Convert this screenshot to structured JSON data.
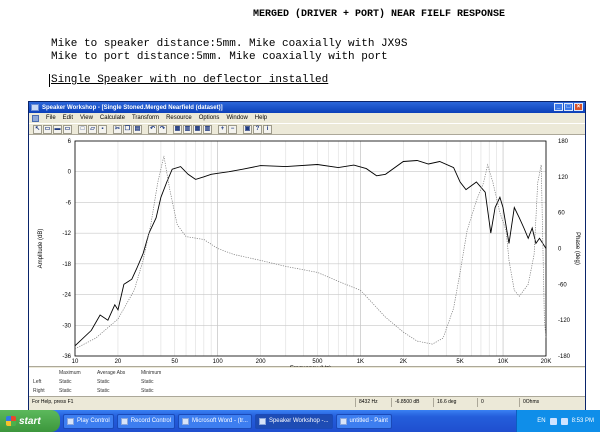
{
  "document": {
    "title": "MERGED (DRIVER + PORT) NEAR FIELF RESPONSE",
    "line1": "Mike to speaker distance:5mm. Mike coaxially with JX9S",
    "line2": "Mike to port distance:5mm. Mike coaxially with port",
    "line3": "Single Speaker with no deflector installed"
  },
  "window": {
    "title": "Speaker Workshop - [Single Stoned.Merged Nearfield (dataset)]",
    "buttons": [
      "_",
      "□",
      "×"
    ],
    "menu": [
      "File",
      "Edit",
      "View",
      "Calculate",
      "Transform",
      "Resource",
      "Options",
      "Window",
      "Help"
    ],
    "toolbar_icons": [
      "pointer-icon",
      "view1-icon",
      "view2-icon",
      "view3-icon",
      "new-icon",
      "open-icon",
      "save-icon",
      "cut-icon",
      "copy-icon",
      "paste-icon",
      "undo-icon",
      "redo-icon",
      "chart1-icon",
      "chart2-icon",
      "chart3-icon",
      "chart4-icon",
      "zoom-in-icon",
      "zoom-out-icon",
      "print-icon",
      "help-icon",
      "about-icon"
    ]
  },
  "chart_data": {
    "type": "line",
    "xlabel": "Frequency (Hz)",
    "ylabel_left": "Amplitude (dB)",
    "ylabel_right": "Phase (deg)",
    "x_scale": "log",
    "xlim": [
      10,
      20000
    ],
    "ylim_left": [
      -36,
      6
    ],
    "ylim_right": [
      -180,
      180
    ],
    "x_ticks": [
      "10",
      "20",
      "50",
      "100",
      "200",
      "500",
      "1K",
      "2K",
      "5K",
      "10K",
      "20K"
    ],
    "y_ticks_left": [
      "6",
      "0",
      "-6",
      "-12",
      "-18",
      "-24",
      "-30",
      "-36"
    ],
    "y_ticks_right": [
      "180",
      "120",
      "60",
      "0",
      "-60",
      "-120",
      "-180"
    ],
    "grid": true,
    "series": [
      {
        "axis": "left",
        "style": "solid",
        "color": "#000000",
        "points": [
          [
            10,
            -34
          ],
          [
            13,
            -31
          ],
          [
            15,
            -28
          ],
          [
            17,
            -29
          ],
          [
            19,
            -26
          ],
          [
            20,
            -27
          ],
          [
            22,
            -22
          ],
          [
            25,
            -21
          ],
          [
            27,
            -19
          ],
          [
            30,
            -16
          ],
          [
            33,
            -12
          ],
          [
            37,
            -9
          ],
          [
            40,
            -5
          ],
          [
            44,
            -2
          ],
          [
            48,
            0.5
          ],
          [
            55,
            1
          ],
          [
            62,
            -0.5
          ],
          [
            70,
            -1.5
          ],
          [
            80,
            -1
          ],
          [
            90,
            -0.5
          ],
          [
            100,
            -0.3
          ],
          [
            120,
            0
          ],
          [
            150,
            0.5
          ],
          [
            200,
            1.2
          ],
          [
            300,
            1
          ],
          [
            500,
            1.4
          ],
          [
            700,
            0.8
          ],
          [
            900,
            1.3
          ],
          [
            1100,
            0.6
          ],
          [
            1300,
            -0.8
          ],
          [
            1500,
            -0.5
          ],
          [
            2000,
            2
          ],
          [
            2500,
            2.2
          ],
          [
            3000,
            1.5
          ],
          [
            3600,
            2
          ],
          [
            4500,
            0.8
          ],
          [
            5000,
            -2
          ],
          [
            5500,
            -3.5
          ],
          [
            6500,
            -2
          ],
          [
            7500,
            -4
          ],
          [
            8200,
            -12
          ],
          [
            8800,
            -7
          ],
          [
            9500,
            -5
          ],
          [
            10000,
            -7
          ],
          [
            11000,
            -14
          ],
          [
            12000,
            -7
          ],
          [
            13000,
            -9
          ],
          [
            14000,
            -11
          ],
          [
            15000,
            -13
          ],
          [
            16000,
            -11
          ],
          [
            17000,
            -14
          ],
          [
            18000,
            -13
          ],
          [
            20000,
            -15
          ]
        ]
      },
      {
        "axis": "right",
        "style": "dotted",
        "color": "#777777",
        "points": [
          [
            10,
            -168
          ],
          [
            14,
            -150
          ],
          [
            20,
            -118
          ],
          [
            26,
            -70
          ],
          [
            30,
            -20
          ],
          [
            34,
            40
          ],
          [
            38,
            110
          ],
          [
            42,
            155
          ],
          [
            46,
            100
          ],
          [
            52,
            40
          ],
          [
            60,
            20
          ],
          [
            80,
            15
          ],
          [
            100,
            0
          ],
          [
            130,
            -10
          ],
          [
            200,
            -20
          ],
          [
            300,
            -30
          ],
          [
            500,
            -40
          ],
          [
            700,
            -55
          ],
          [
            1000,
            -70
          ],
          [
            1200,
            -90
          ],
          [
            1500,
            -115
          ],
          [
            2000,
            -140
          ],
          [
            2500,
            -155
          ],
          [
            3200,
            -160
          ],
          [
            3800,
            -150
          ],
          [
            4500,
            -100
          ],
          [
            5000,
            -40
          ],
          [
            5600,
            30
          ],
          [
            6500,
            80
          ],
          [
            7300,
            110
          ],
          [
            7800,
            140
          ],
          [
            8500,
            110
          ],
          [
            9500,
            60
          ],
          [
            10500,
            30
          ],
          [
            11000,
            -20
          ],
          [
            12000,
            -70
          ],
          [
            13000,
            -80
          ],
          [
            15000,
            -60
          ],
          [
            16500,
            -10
          ],
          [
            17500,
            110
          ],
          [
            18500,
            140
          ],
          [
            19500,
            -120
          ],
          [
            20000,
            -150
          ]
        ]
      }
    ]
  },
  "table": {
    "headers": [
      "Maximum",
      "Average Abs",
      "Minimum"
    ],
    "rows": [
      {
        "label": "Left",
        "values": [
          "Static",
          "Static",
          "Static"
        ]
      },
      {
        "label": "Right",
        "values": [
          "Static",
          "Static",
          "Static"
        ]
      }
    ]
  },
  "status": {
    "help": "For Help, press F1",
    "freq": "8432 Hz",
    "db": "-6.8500 dB",
    "deg": "16.6 deg",
    "zero": "0",
    "ohms": "0Ohms"
  },
  "taskbar": {
    "start": "start",
    "items": [
      "Play Control",
      "Record Control",
      "Microsoft Word - (tr...",
      "Speaker Workshop -...",
      "untitled - Paint"
    ],
    "active_index": 3,
    "lang": "EN",
    "time": "8:53 PM"
  }
}
